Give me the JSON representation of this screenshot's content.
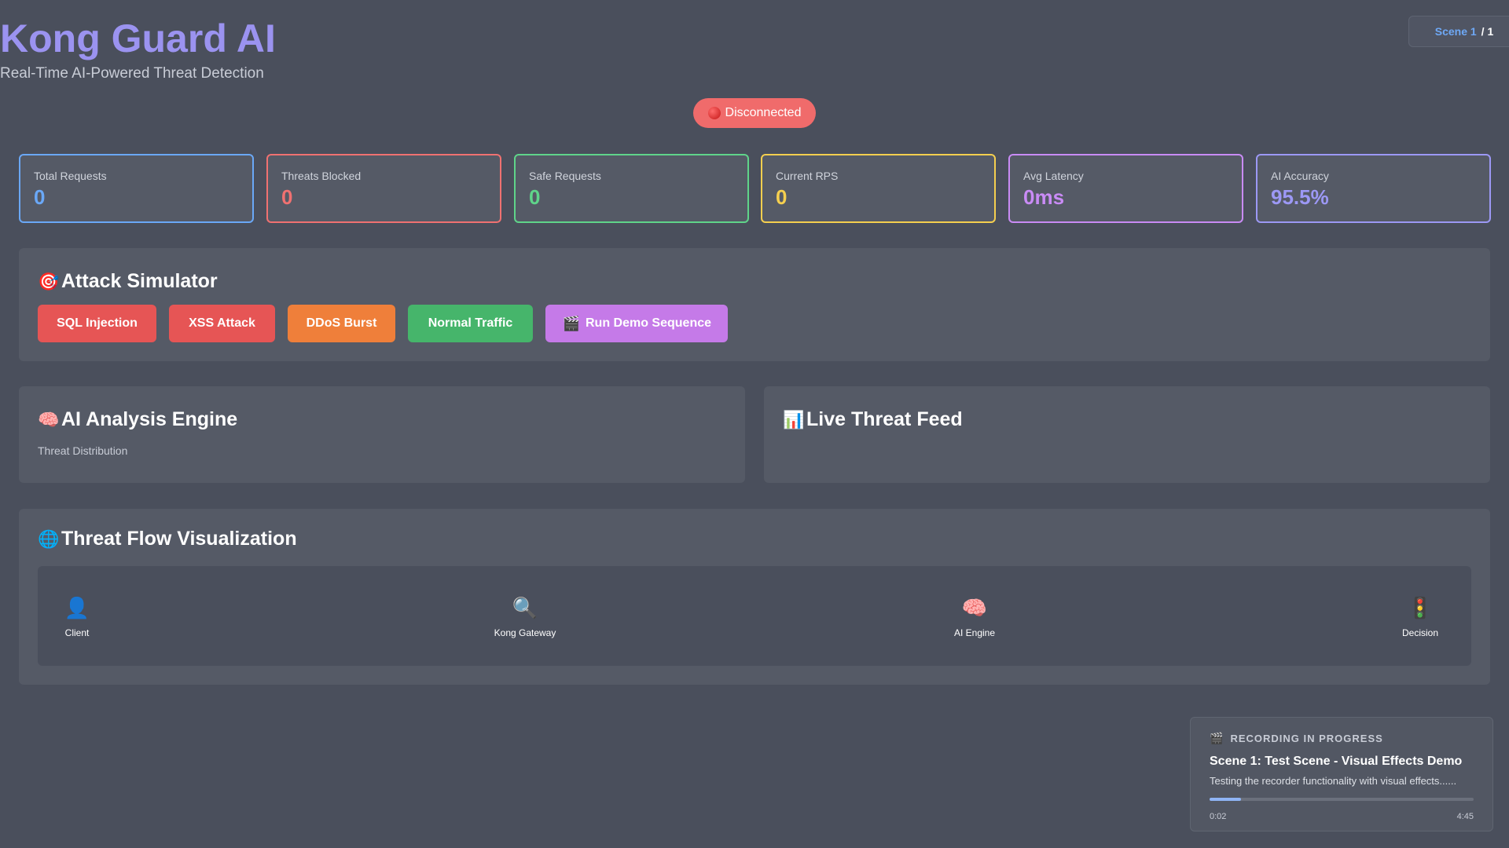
{
  "header": {
    "title": "Kong Guard AI",
    "subtitle": "Real-Time AI-Powered Threat Detection",
    "status": "Disconnected"
  },
  "scene_indicator": {
    "label": "Scene 1",
    "total": "/ 1"
  },
  "stats": [
    {
      "label": "Total Requests",
      "value": "0",
      "color": "#6aa8f7"
    },
    {
      "label": "Threats Blocked",
      "value": "0",
      "color": "#f07171"
    },
    {
      "label": "Safe Requests",
      "value": "0",
      "color": "#5fd48a"
    },
    {
      "label": "Current RPS",
      "value": "0",
      "color": "#f5cf4f"
    },
    {
      "label": "Avg Latency",
      "value": "0ms",
      "color": "#c98bf5"
    },
    {
      "label": "AI Accuracy",
      "value": "95.5%",
      "color": "#9c98f5"
    }
  ],
  "attack_simulator": {
    "title": "Attack Simulator",
    "icon": "target-icon",
    "buttons": [
      {
        "label": "SQL Injection",
        "color": "#e65555"
      },
      {
        "label": "XSS Attack",
        "color": "#e65555"
      },
      {
        "label": "DDoS Burst",
        "color": "#ef7f3a"
      },
      {
        "label": "Normal Traffic",
        "color": "#46b56b"
      },
      {
        "label": "Run Demo Sequence",
        "color": "#c57ae8",
        "icon": "clapper-icon"
      }
    ]
  },
  "ai_engine": {
    "title": "AI Analysis Engine",
    "icon": "brain-icon",
    "subtitle": "Threat Distribution"
  },
  "threat_feed": {
    "title": "Live Threat Feed",
    "icon": "bar-chart-icon"
  },
  "threat_flow": {
    "title": "Threat Flow Visualization",
    "icon": "globe-icon",
    "nodes": [
      {
        "label": "Client",
        "icon": "user-icon"
      },
      {
        "label": "Kong Gateway",
        "icon": "magnifier-icon"
      },
      {
        "label": "AI Engine",
        "icon": "brain-icon"
      },
      {
        "label": "Decision",
        "icon": "traffic-light-icon"
      }
    ]
  },
  "recording": {
    "header": "RECORDING IN PROGRESS",
    "title": "Scene 1: Test Scene - Visual Effects Demo",
    "description": "Testing the recorder functionality with visual effects......",
    "elapsed": "0:02",
    "duration": "4:45",
    "progress": 0.12
  }
}
